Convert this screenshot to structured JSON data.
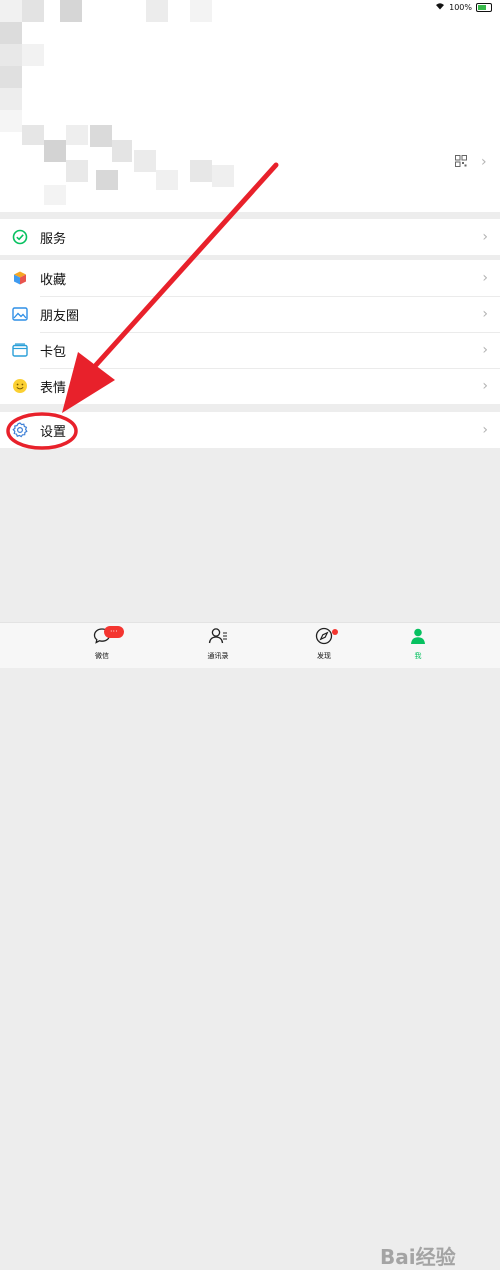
{
  "status_bar": {
    "battery": "100%"
  },
  "menu": {
    "services": {
      "label": "服务"
    },
    "items": [
      {
        "label": "收藏"
      },
      {
        "label": "朋友圈"
      },
      {
        "label": "卡包"
      },
      {
        "label": "表情"
      }
    ],
    "settings": {
      "label": "设置"
    }
  },
  "tabbar": {
    "tabs": [
      {
        "label": "微信",
        "badge": "···"
      },
      {
        "label": "通讯录"
      },
      {
        "label": "发现"
      },
      {
        "label": "我"
      }
    ]
  },
  "watermark": "Bai经验",
  "colors": {
    "accent_green": "#07c160",
    "annotation_red": "#e8212b",
    "badge_red": "#f43530"
  }
}
